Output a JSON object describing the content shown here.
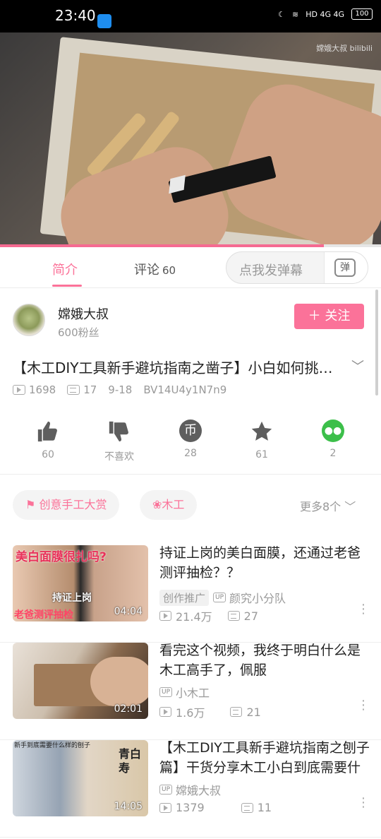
{
  "status_bar": {
    "time": "23:40",
    "network": "HD 4G 4G",
    "battery": "100"
  },
  "video": {
    "watermark": "嫦娥大叔 bilibili",
    "progress_fraction": 0.85
  },
  "tabs": {
    "intro": "简介",
    "comments": "评论",
    "comments_count": "60",
    "danmaku_placeholder": "点我发弹幕",
    "danmaku_button": "弹"
  },
  "author": {
    "name": "嫦娥大叔",
    "fans": "600粉丝",
    "follow_label": "关注",
    "follow_icon": "plus-icon"
  },
  "video_info": {
    "title": "【木工DIY工具新手避坑指南之凿子】小白如何挑选凿子",
    "views": "1698",
    "danmaku": "17",
    "date": "9-18",
    "bvid": "BV14U4y1N7n9"
  },
  "actions": [
    {
      "icon": "thumbs-up-icon",
      "label": "60"
    },
    {
      "icon": "thumbs-down-icon",
      "label": "不喜欢"
    },
    {
      "icon": "coin-icon",
      "label": "28"
    },
    {
      "icon": "star-icon",
      "label": "61"
    },
    {
      "icon": "wechat-icon",
      "label": "2"
    }
  ],
  "tags": [
    {
      "icon": "flag-icon",
      "label": "创意手工大赏"
    },
    {
      "icon": "dots-icon",
      "label": "木工"
    }
  ],
  "more_tags": "更多8个",
  "recommendations": [
    {
      "title": "持证上岗的美白面膜，还通过老爸测评抽检？？",
      "duration": "04:04",
      "promo": "创作推广",
      "up": "颜究小分队",
      "views": "21.4万",
      "danmaku": "27",
      "thumb_text_top": "美白面膜很扎吗?",
      "thumb_text_mid": "持证上岗",
      "thumb_text_bottom": "老爸测评抽检"
    },
    {
      "title": "看完这个视频，我终于明白什么是木工高手了，佩服",
      "duration": "02:01",
      "up": "小木工",
      "views": "1.6万",
      "danmaku": "21"
    },
    {
      "title": "【木工DIY工具新手避坑指南之刨子篇】干货分享木工小白到底需要什么样的刨子",
      "duration": "14:05",
      "up": "嫦娥大叔",
      "views": "1379",
      "danmaku": "11",
      "thumb_text_top": "新手到底需要什么样的刨子",
      "thumb_text_side": "青白寿"
    }
  ]
}
